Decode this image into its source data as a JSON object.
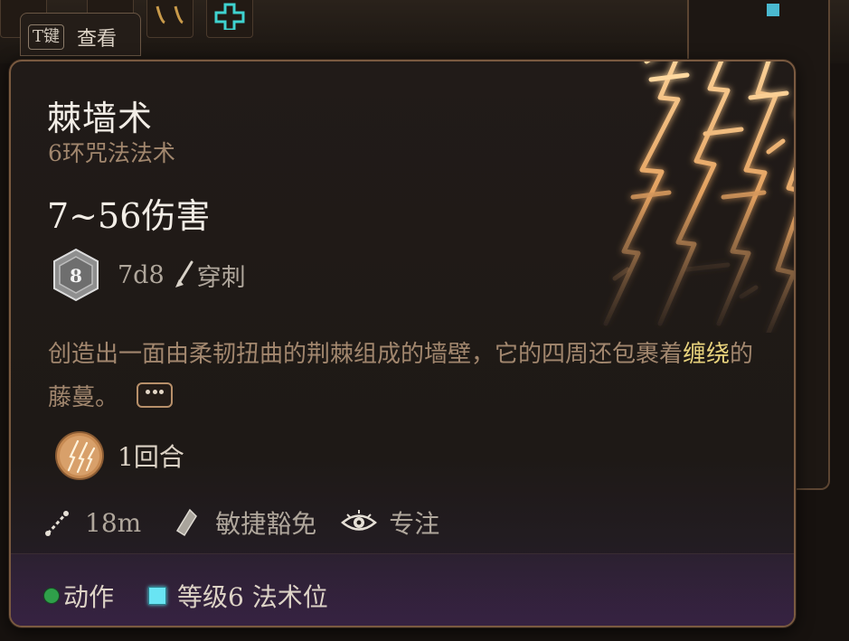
{
  "key_hint": {
    "key": "T键",
    "label": "查看"
  },
  "spell": {
    "name": "棘墙术",
    "level_school": "6环咒法法术",
    "damage": "7~56伤害",
    "dice": "7d8",
    "dice_face": "8",
    "damage_type": "穿刺",
    "description_before": "创造出一面由柔韧扭曲的荆棘组成的墙壁，它的四周还包裹着",
    "description_highlight": "缠绕",
    "description_after": "的藤蔓。",
    "duration": "1回合",
    "range": "18m",
    "save": "敏捷豁免",
    "concentration": "专注"
  },
  "footer": {
    "action": "动作",
    "slot": "等级6 法术位"
  },
  "colors": {
    "title": "#f2ede6",
    "muted_brown": "#a2876e",
    "keyword_yellow": "#e8d27c",
    "action_green": "#2fa04a",
    "spell_slot_cyan": "#69e4f3",
    "border_bronze": "#7a5a40"
  },
  "icons": {
    "dice": "d8-dice-icon",
    "pierce": "arrow-pierce-icon",
    "duration": "thorn-turn-icon",
    "range": "range-line-icon",
    "save": "shield-save-icon",
    "concentration": "eye-concentration-icon",
    "expand": "ellipsis-more-icon"
  }
}
